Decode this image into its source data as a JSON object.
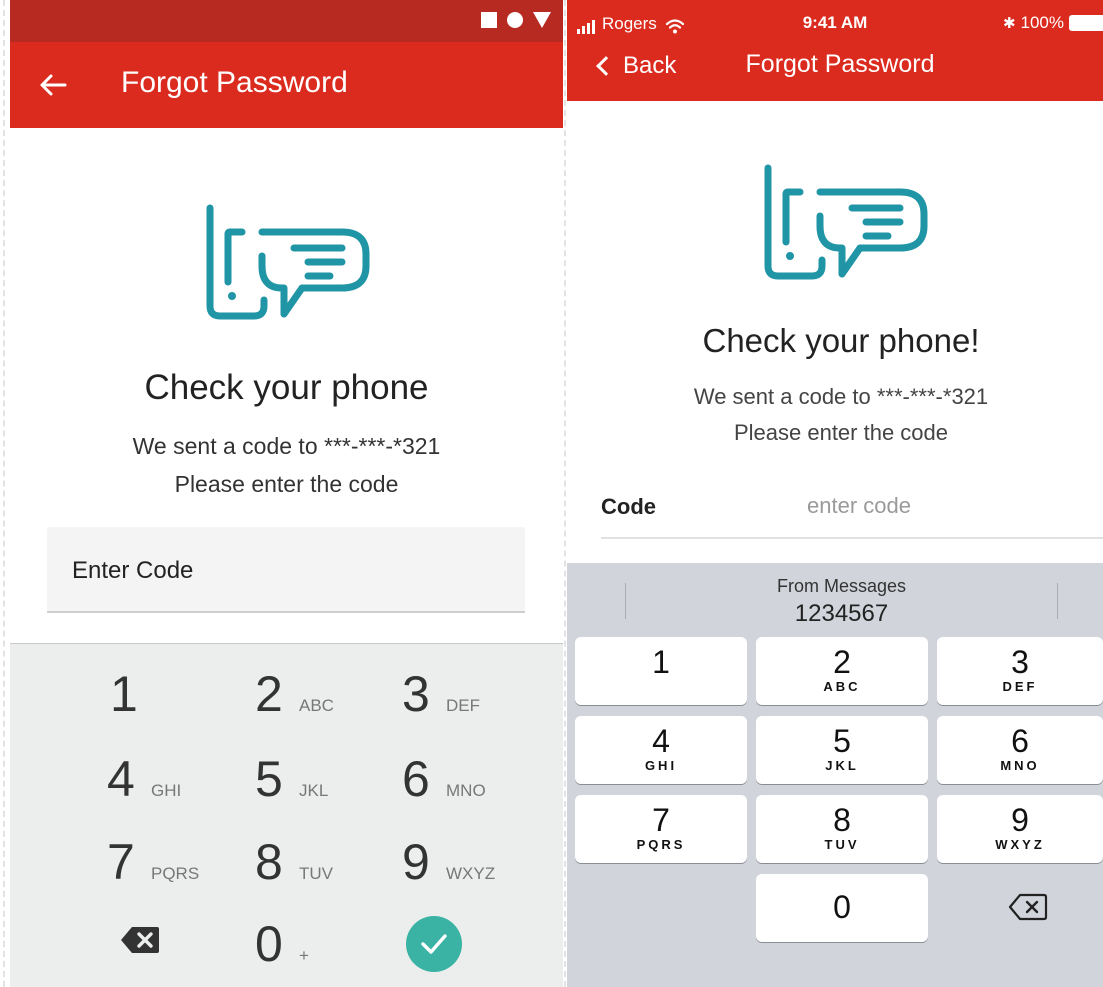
{
  "android": {
    "title": "Forgot Password",
    "heading": "Check your phone",
    "subtitle_line1": "We sent a code to ***-***-*321",
    "subtitle_line2": "Please enter the code",
    "field_label": "Enter Code",
    "keypad": [
      {
        "digit": "1",
        "letters": ""
      },
      {
        "digit": "2",
        "letters": "ABC"
      },
      {
        "digit": "3",
        "letters": "DEF"
      },
      {
        "digit": "4",
        "letters": "GHI"
      },
      {
        "digit": "5",
        "letters": "JKL"
      },
      {
        "digit": "6",
        "letters": "MNO"
      },
      {
        "digit": "7",
        "letters": "PQRS"
      },
      {
        "digit": "8",
        "letters": "TUV"
      },
      {
        "digit": "9",
        "letters": "WXYZ"
      },
      {
        "digit": "0",
        "letters": "+"
      }
    ],
    "icons": {
      "back": "arrow-left-icon",
      "delete": "backspace-icon",
      "submit": "check-icon",
      "logo": "phone-chat-icon"
    },
    "colors": {
      "status_bar": "#b62a22",
      "app_bar": "#db2b1f",
      "accent": "#3ab3a5",
      "logo": "#1f95a6"
    }
  },
  "ios": {
    "carrier": "Rogers",
    "time": "9:41 AM",
    "battery": "100%",
    "back_label": "Back",
    "title": "Forgot Password",
    "heading": "Check your phone!",
    "subtitle_line1": "We sent a code to ***-***-*321",
    "subtitle_line2": "Please enter the code",
    "code_label": "Code",
    "code_placeholder": "enter code",
    "suggestion_source": "From Messages",
    "suggestion_code": "1234567",
    "keys": [
      {
        "digit": "1",
        "letters": ""
      },
      {
        "digit": "2",
        "letters": "ABC"
      },
      {
        "digit": "3",
        "letters": "DEF"
      },
      {
        "digit": "4",
        "letters": "GHI"
      },
      {
        "digit": "5",
        "letters": "JKL"
      },
      {
        "digit": "6",
        "letters": "MNO"
      },
      {
        "digit": "7",
        "letters": "PQRS"
      },
      {
        "digit": "8",
        "letters": "TUV"
      },
      {
        "digit": "9",
        "letters": "WXYZ"
      },
      {
        "digit": "0",
        "letters": ""
      }
    ],
    "icons": {
      "back": "chevron-left-icon",
      "wifi": "wifi-icon",
      "bluetooth": "bluetooth-icon",
      "battery": "battery-icon",
      "delete": "backspace-icon",
      "logo": "phone-chat-icon"
    },
    "colors": {
      "header": "#db2b1f",
      "keyboard": "#d1d5db",
      "logo": "#1f95a6"
    }
  }
}
